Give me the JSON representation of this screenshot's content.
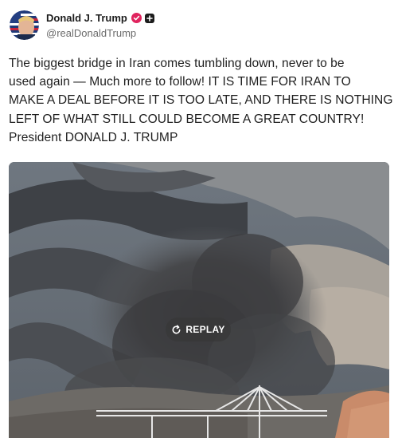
{
  "post": {
    "author": {
      "display_name": "Donald J. Trump",
      "handle": "@realDonaldTrump",
      "verified_icon": "verified-badge-icon",
      "extra_icon": "plus-square-icon"
    },
    "text_lines": [
      "The biggest bridge in Iran comes tumbling down, never to be",
      "used again — Much more to follow! IT IS TIME FOR IRAN TO",
      "MAKE A DEAL BEFORE IT IS TOO LATE, AND THERE IS NOTHING",
      "LEFT OF WHAT STILL COULD BECOME A GREAT COUNTRY!",
      "President DONALD J. TRUMP"
    ],
    "media": {
      "replay_label": "REPLAY",
      "replay_icon": "replay-icon"
    }
  },
  "colors": {
    "badge": "#e0245e",
    "text": "#1f1f1f",
    "handle": "#6b6b6b"
  }
}
